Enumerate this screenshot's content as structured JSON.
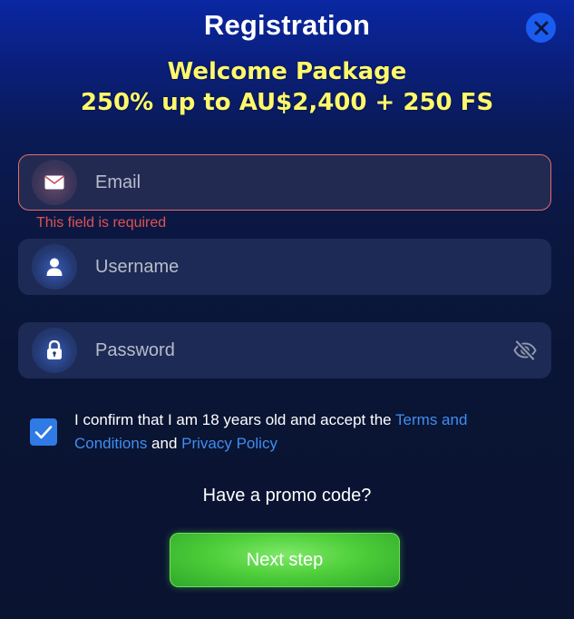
{
  "header": {
    "title": "Registration",
    "close_icon": "close-icon"
  },
  "promo": {
    "line1": "Welcome Package",
    "line2": "250% up to AU$2,400 + 250 FS"
  },
  "form": {
    "email": {
      "placeholder": "Email",
      "icon": "envelope-icon",
      "error": "This field is required"
    },
    "username": {
      "placeholder": "Username",
      "icon": "user-icon"
    },
    "password": {
      "placeholder": "Password",
      "icon": "lock-icon",
      "toggle_icon": "eye-off-icon"
    }
  },
  "consent": {
    "checked": true,
    "text_before": "I confirm that I am 18 years old and accept the ",
    "terms_link": "Terms and Conditions",
    "text_middle": " and ",
    "privacy_link": "Privacy Policy"
  },
  "promo_code_link": "Have a promo code?",
  "next_button": "Next step",
  "colors": {
    "accent_yellow": "#fff96b",
    "link_blue": "#3f8ef0",
    "error_red": "#e05252",
    "button_green": "#4fcf3a",
    "close_blue": "#1a5cf0"
  }
}
